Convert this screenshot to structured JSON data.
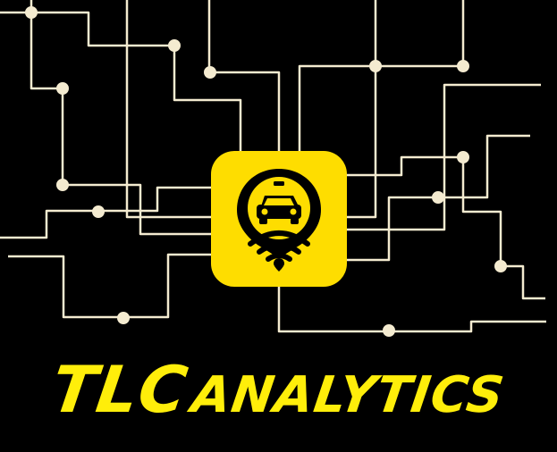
{
  "logo": {
    "brand_word": "TLC",
    "product_word": "analytics"
  },
  "icon": "taxi-location-pin-icon",
  "colors": {
    "background": "#000000",
    "accent": "#FEDD00",
    "title": "#FFEE0A",
    "lines": "#F4EBD0"
  }
}
